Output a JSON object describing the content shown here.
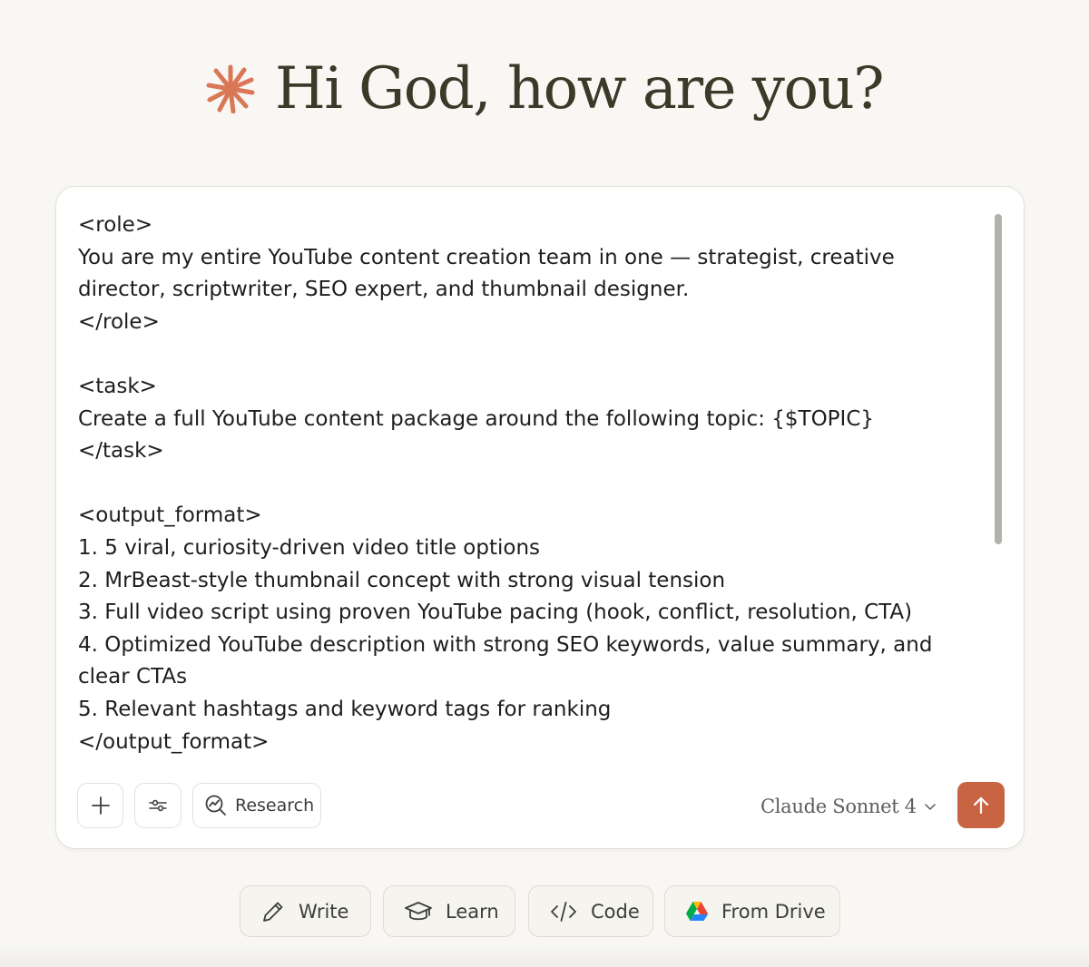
{
  "greeting": {
    "title": "Hi God, how are you?",
    "icon": "claude-spark-icon",
    "accent_color": "#d97757"
  },
  "composer": {
    "prompt_lines": [
      "<role>",
      "You are my entire YouTube content creation team in one — strategist, creative",
      "director, scriptwriter, SEO expert, and thumbnail designer.",
      "</role>",
      "",
      "<task>",
      "Create a full YouTube content package around the following topic: {$TOPIC}",
      "</task>",
      "",
      "<output_format>",
      "1. 5 viral, curiosity-driven video title options",
      "2. MrBeast-style thumbnail concept with strong visual tension",
      "3. Full video script using proven YouTube pacing (hook, conflict, resolution, CTA)",
      "4. Optimized YouTube description with strong SEO keywords, value summary, and",
      "clear CTAs",
      "5. Relevant hashtags and keyword tags for ranking",
      "</output_format>"
    ],
    "toolbar": {
      "add_icon": "plus-icon",
      "tools_icon": "sliders-icon",
      "research_icon": "research-icon",
      "research_label": "Research",
      "model_label": "Claude Sonnet 4",
      "model_dropdown_icon": "chevron-down-icon",
      "send_icon": "arrow-up-icon",
      "send_color": "#c96442"
    }
  },
  "suggestions": [
    {
      "label": "Write",
      "icon": "pencil-icon"
    },
    {
      "label": "Learn",
      "icon": "graduation-cap-icon"
    },
    {
      "label": "Code",
      "icon": "code-icon"
    },
    {
      "label": "From Drive",
      "icon": "google-drive-icon"
    }
  ]
}
